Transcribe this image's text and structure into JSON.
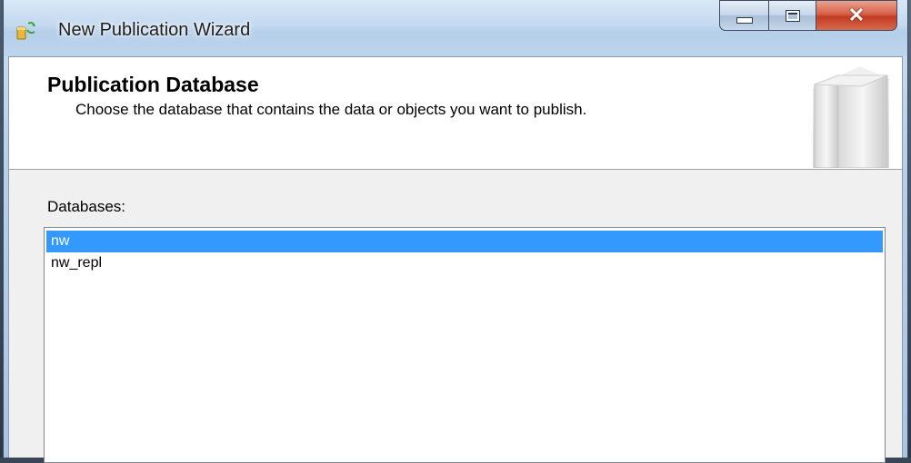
{
  "window": {
    "title": "New Publication Wizard",
    "icon": "wizard-icon",
    "caption_buttons": [
      "minimize-icon",
      "maximize-icon",
      "close-icon"
    ]
  },
  "header": {
    "title": "Publication Database",
    "subtitle": "Choose the database that contains the data or objects you want to publish.",
    "graphic": "database-graphic"
  },
  "main": {
    "databases_label": "Databases:",
    "databases": [
      {
        "name": "nw",
        "selected": true
      },
      {
        "name": "nw_repl",
        "selected": false
      }
    ]
  },
  "colors": {
    "selection": "#3399ff",
    "close_button": "#c23b22"
  }
}
